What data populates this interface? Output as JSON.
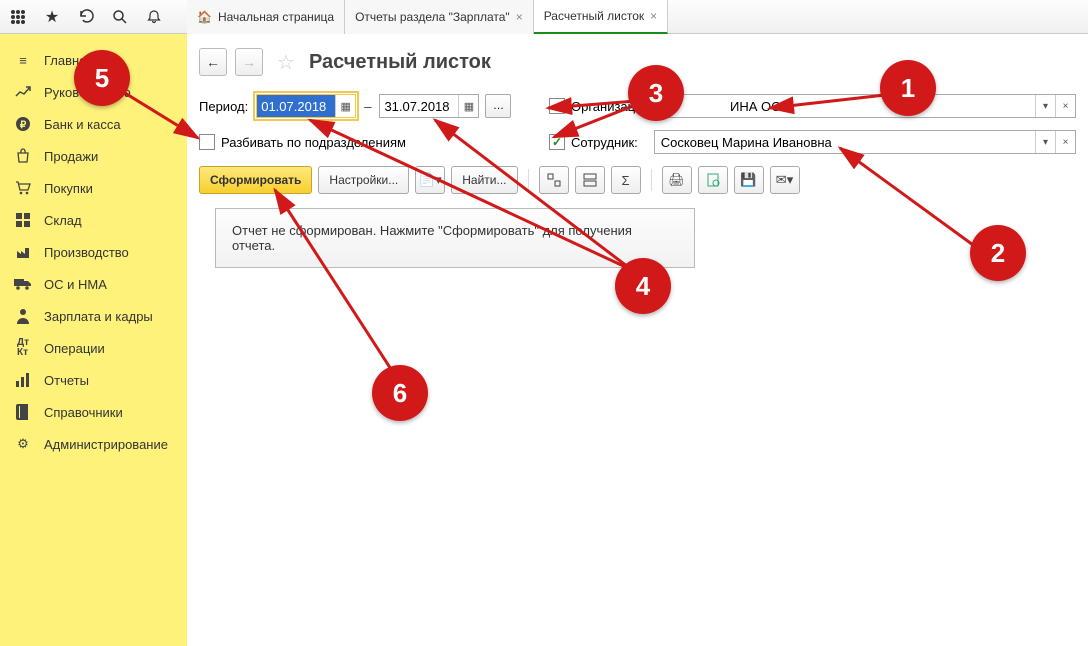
{
  "tabs": {
    "home": "Начальная страница",
    "reports": "Отчеты раздела \"Зарплата\"",
    "payslip": "Расчетный листок"
  },
  "sidebar": {
    "items": [
      {
        "label": "Главное",
        "icon": "≡"
      },
      {
        "label": "Руководителю",
        "icon": "chart"
      },
      {
        "label": "Банк и касса",
        "icon": "₽"
      },
      {
        "label": "Продажи",
        "icon": "bag"
      },
      {
        "label": "Покупки",
        "icon": "cart"
      },
      {
        "label": "Склад",
        "icon": "grid"
      },
      {
        "label": "Производство",
        "icon": "factory"
      },
      {
        "label": "ОС и НМА",
        "icon": "truck"
      },
      {
        "label": "Зарплата и кадры",
        "icon": "person"
      },
      {
        "label": "Операции",
        "icon": "ops"
      },
      {
        "label": "Отчеты",
        "icon": "bars"
      },
      {
        "label": "Справочники",
        "icon": "book"
      },
      {
        "label": "Администрирование",
        "icon": "gear"
      }
    ]
  },
  "page": {
    "title": "Расчетный листок",
    "period_label": "Период:",
    "date_from": "01.07.2018",
    "date_to": "31.07.2018",
    "org_label": "Организация:",
    "org_value": "ИНА ООО",
    "split_label": "Разбивать по подразделениям",
    "emp_label": "Сотрудник:",
    "emp_value": "Сосковец Марина Ивановна",
    "btn_generate": "Сформировать",
    "btn_settings": "Настройки...",
    "btn_find": "Найти...",
    "report_placeholder": "Отчет не сформирован. Нажмите \"Сформировать\" для получения отчета."
  },
  "markers": {
    "m1": "1",
    "m2": "2",
    "m3": "3",
    "m4": "4",
    "m5": "5",
    "m6": "6"
  }
}
